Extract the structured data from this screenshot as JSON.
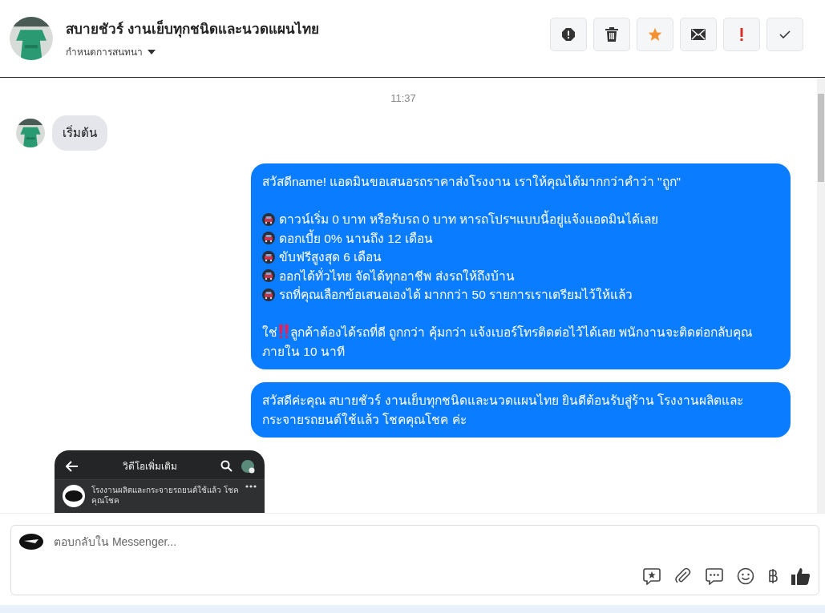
{
  "header": {
    "title": "สบายชัวร์ งานเย็บทุกชนิดและนวดแผนไทย",
    "subtitle": "กำหนดการสนทนา"
  },
  "actions": [
    {
      "kind": "alert"
    },
    {
      "kind": "trash"
    },
    {
      "kind": "star"
    },
    {
      "kind": "mail"
    },
    {
      "kind": "exclaim"
    },
    {
      "kind": "check"
    }
  ],
  "time": "11:37",
  "messages": [
    {
      "kind": "incoming",
      "text": "เริ่มต้น"
    },
    {
      "kind": "outgoing",
      "lines": [
        {
          "kind": "text",
          "text": "สวัสดีname! แอดมินขอเสนอรถราคาส่งโรงงาน เราให้คุณได้มากกว่าคำว่า \"ถูก\""
        },
        {
          "kind": "bullet",
          "text": "ดาวน์เริ่ม 0 บาท หรือรับรถ 0 บาท หารถโปรฯแบบนี้อยู่แจ้งแอดมินได้เลย"
        },
        {
          "kind": "bullet",
          "text": "ดอกเบี้ย 0% นานถึง 12 เดือน"
        },
        {
          "kind": "bullet",
          "text": "ขับฟรีสูงสุด 6 เดือน"
        },
        {
          "kind": "bullet",
          "text": "ออกได้ทั่วไทย จัดได้ทุกอาชีพ ส่งรถให้ถึงบ้าน"
        },
        {
          "kind": "bullet",
          "text": "รถที่คุณเลือกข้อเสนอเองได้ มากกว่า 50 รายการเราเตรียมไว้ให้แล้ว"
        },
        {
          "kind": "emphasis",
          "lead": "ใช่",
          "text": "ลูกค้าต้องได้รถที่ดี ถูกกว่า คุ้มกว่า แจ้งเบอร์โทรติดต่อไว้ได้เลย พนักงานจะติดต่อกลับคุณภายใน 10 นาที"
        }
      ]
    },
    {
      "kind": "outgoing",
      "lines": [
        {
          "kind": "text",
          "text": "สวัสดีค่ะคุณ สบายชัวร์ งานเย็บทุกชนิดและนวดแผนไทย ยินดีต้อนรับสู่ร้าน โรงงานผลิตและกระจายรถยนต์ใช้แล้ว โชคคุณโชค ค่ะ"
        }
      ]
    },
    {
      "kind": "screenshot",
      "title": "วิดีโอเพิ่มเติม",
      "page": "โรงงานผลิตและกระจายรถยนต์ใช้แล้ว โชค คุณโชค"
    }
  ],
  "composer": {
    "placeholder": "ตอบกลับใน Messenger..."
  },
  "tools": [
    {
      "kind": "sticker"
    },
    {
      "kind": "attach"
    },
    {
      "kind": "chat"
    },
    {
      "kind": "emoji"
    },
    {
      "kind": "baht"
    },
    {
      "kind": "like"
    }
  ]
}
